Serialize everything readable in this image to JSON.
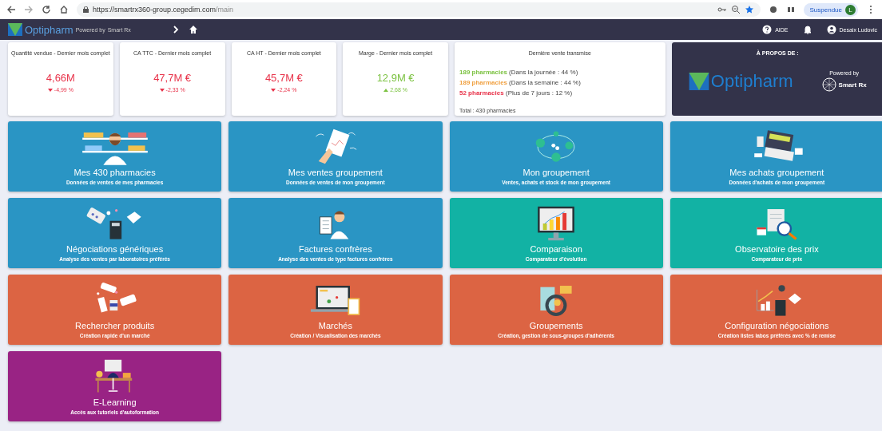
{
  "browser": {
    "url_host": "https://smartrx360-group.cegedim.com",
    "url_path": "/main",
    "profile_button": "Suspendue",
    "profile_initial": "L"
  },
  "header": {
    "logo": "Optipharm",
    "powered_by": "Powered by",
    "partner": "Smart Rx",
    "help": "AIDE",
    "user": "Desaix Ludovic"
  },
  "kpis": [
    {
      "title": "Quantité vendue - Dernier mois complet",
      "value": "4,66M",
      "change": "-4,99 %",
      "rising": false
    },
    {
      "title": "CA TTC - Dernier mois complet",
      "value": "47,7M €",
      "change": "-2,33 %",
      "rising": false
    },
    {
      "title": "CA HT - Dernier mois complet",
      "value": "45,7M €",
      "change": "-2,24 %",
      "rising": false
    },
    {
      "title": "Marge - Dernier mois complet",
      "value": "12,9M €",
      "change": "2,68 %",
      "rising": true
    }
  ],
  "last_sale": {
    "title": "Dernière vente transmise",
    "lines": [
      {
        "count": "189 pharmacies",
        "detail": "(Dans la journée : 44 %)",
        "color": "#7cc242"
      },
      {
        "count": "189 pharmacies",
        "detail": "(Dans la semaine : 44 %)",
        "color": "#f0a040"
      },
      {
        "count": "52 pharmacies",
        "detail": "(Plus de 7 jours : 12 %)",
        "color": "#e8334a"
      }
    ],
    "total": "Total : 430 pharmacies"
  },
  "about": {
    "title": "À PROPOS DE :",
    "logo": "Optipharm",
    "powered_by": "Powered by",
    "partner": "Smart Rx"
  },
  "tiles": [
    {
      "title": "Mes 430 pharmacies",
      "subtitle": "Données de ventes de mes pharmacies",
      "color": "#2a95c4"
    },
    {
      "title": "Mes ventes groupement",
      "subtitle": "Données de ventes de mon groupement",
      "color": "#2a95c4"
    },
    {
      "title": "Mon groupement",
      "subtitle": "Ventes, achats et stock de mon groupement",
      "color": "#2a95c4"
    },
    {
      "title": "Mes achats groupement",
      "subtitle": "Données d'achats de mon groupement",
      "color": "#2a95c4"
    },
    {
      "title": "Négociations génériques",
      "subtitle": "Analyse des ventes par laboratoires préférés",
      "color": "#2a95c4"
    },
    {
      "title": "Factures confrères",
      "subtitle": "Analyse des ventes de type factures confrères",
      "color": "#2a95c4"
    },
    {
      "title": "Comparaison",
      "subtitle": "Comparateur d'évolution",
      "color": "#12b2a4"
    },
    {
      "title": "Observatoire des prix",
      "subtitle": "Comparateur de prix",
      "color": "#12b2a4"
    },
    {
      "title": "Rechercher produits",
      "subtitle": "Création rapide d'un marché",
      "color": "#dc6443"
    },
    {
      "title": "Marchés",
      "subtitle": "Création / Visualisation des marchés",
      "color": "#dc6443"
    },
    {
      "title": "Groupements",
      "subtitle": "Création, gestion de sous-groupes d'adhérents",
      "color": "#dc6443"
    },
    {
      "title": "Configuration négociations",
      "subtitle": "Création listes labos préférés avec % de remise",
      "color": "#dc6443"
    },
    {
      "title": "E-Learning",
      "subtitle": "Accès aux tutoriels d'autoformation",
      "color": "#992384"
    }
  ]
}
